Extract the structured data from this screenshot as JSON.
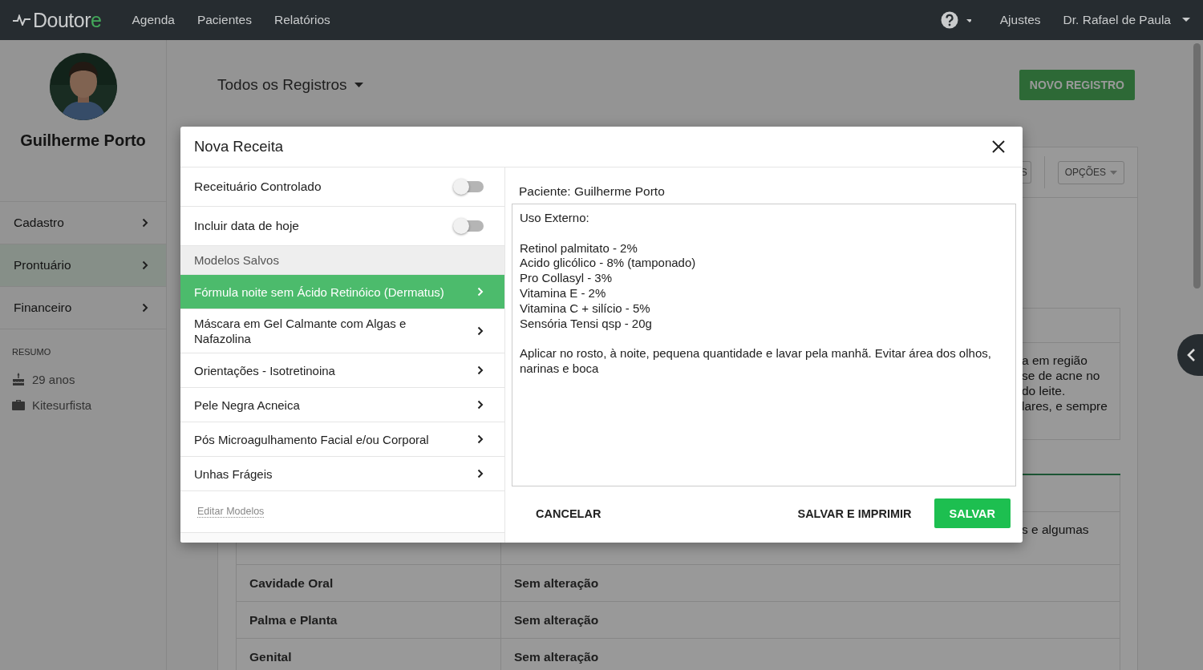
{
  "nav": {
    "logo": "Doutore",
    "links": [
      "Agenda",
      "Pacientes",
      "Relatórios"
    ],
    "settings": "Ajustes",
    "user": "Dr. Rafael de Paula"
  },
  "sidebar": {
    "patient_name": "Guilherme Porto",
    "menu": [
      {
        "label": "Cadastro",
        "selected": false
      },
      {
        "label": "Prontuário",
        "selected": true
      },
      {
        "label": "Financeiro",
        "selected": false
      }
    ],
    "summary_title": "RESUMO",
    "summary": [
      {
        "kind": "age",
        "text": "29 anos"
      },
      {
        "kind": "job",
        "text": "Kitesurfista"
      }
    ]
  },
  "main": {
    "records_filter": "Todos os Registros",
    "new_button": "NOVO REGISTRO",
    "toolbar": {
      "partial_button": "S",
      "options_button": "OPÇÕES"
    },
    "visible_fragments": {
      "block_1": [
        "a em região",
        "se de acne no",
        "do leite.",
        "lares, e sempre"
      ],
      "block_2": "s e algumas"
    },
    "table_rows": [
      {
        "label": "Cavidade Oral",
        "value": "Sem alteração"
      },
      {
        "label": "Palma e Planta",
        "value": "Sem alteração"
      },
      {
        "label": "Genital",
        "value": "Sem alteração"
      }
    ]
  },
  "modal": {
    "title": "Nova Receita",
    "toggles": [
      {
        "label": "Receituário Controlado",
        "on": false
      },
      {
        "label": "Incluir data de hoje",
        "on": false
      }
    ],
    "models_header": "Modelos Salvos",
    "models": [
      {
        "label": "Fórmula noite sem Ácido Retinóico (Dermatus)",
        "selected": true
      },
      {
        "label": "Máscara em Gel Calmante com Algas e Nafazolina",
        "selected": false
      },
      {
        "label": "Orientações - Isotretinoina",
        "selected": false
      },
      {
        "label": "Pele Negra Acneica",
        "selected": false
      },
      {
        "label": "Pós Microagulhamento Facial e/ou Corporal",
        "selected": false
      },
      {
        "label": "Unhas Frágeis",
        "selected": false
      }
    ],
    "edit_models_link": "Editar Modelos",
    "patient_line": "Paciente: Guilherme Porto",
    "prescription_text": "Uso Externo:\n\nRetinol palmitato - 2%\nAcido glicólico - 8% (tamponado)\nPro Collasyl - 3%\nVitamina E - 2%\nVitamina C + silício - 5%\nSensória Tensi qsp - 20g\n\nAplicar no rosto, à noite, pequena quantidade e lavar pela manhã. Evitar área dos olhos, narinas e boca",
    "cancel_button": "CANCELAR",
    "save_print_button": "SALVAR E IMPRIMIR",
    "save_button": "SALVAR"
  }
}
